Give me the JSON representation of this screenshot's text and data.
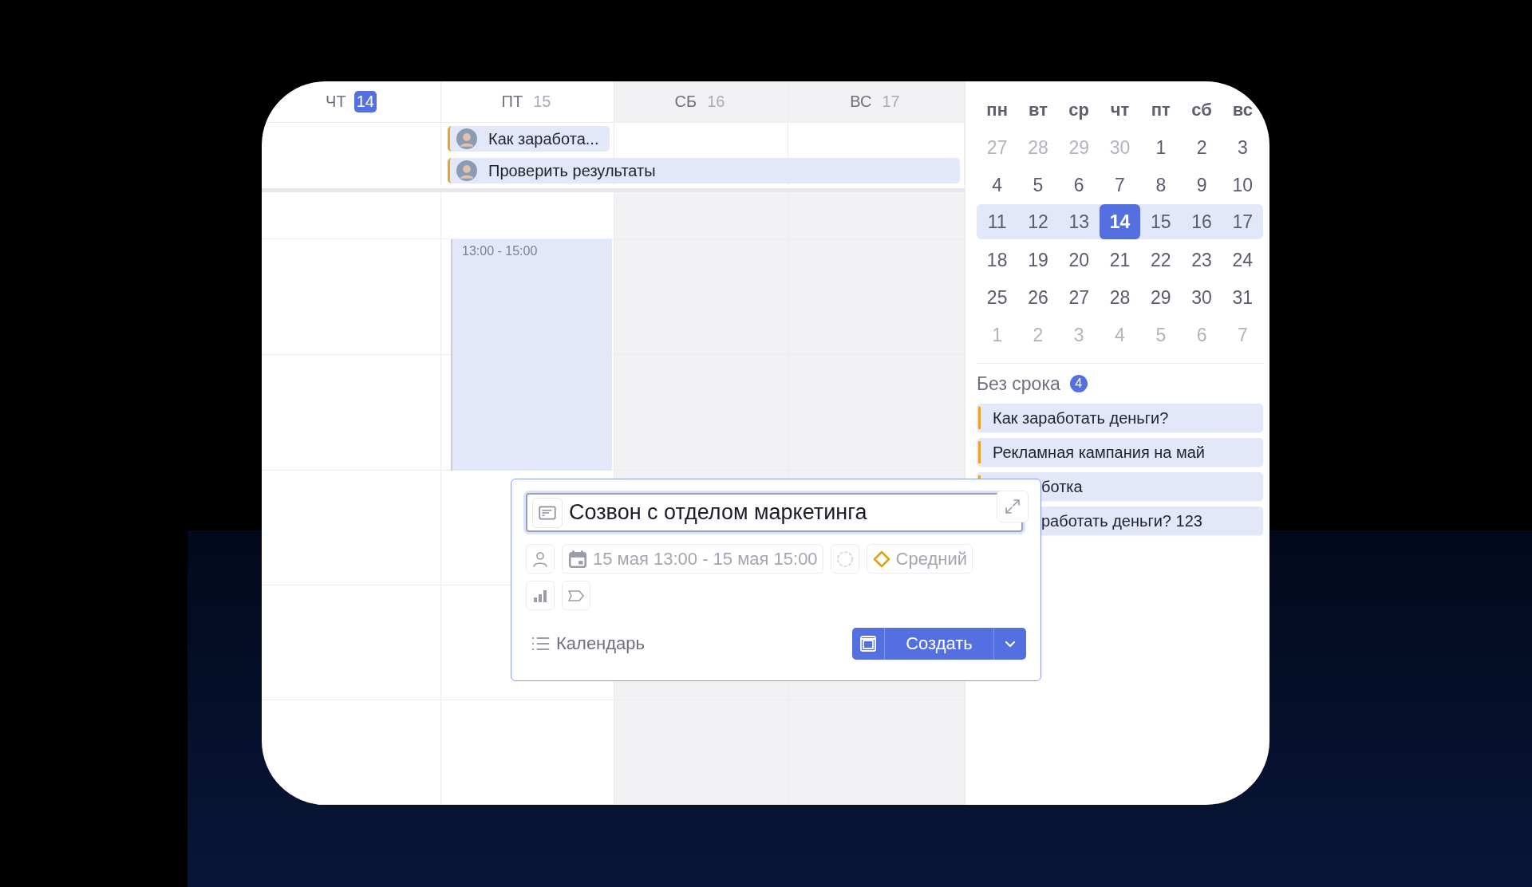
{
  "week_days": [
    {
      "label": "ЧТ",
      "date": "14",
      "today": true,
      "weekend": false
    },
    {
      "label": "ПТ",
      "date": "15",
      "today": false,
      "weekend": false,
      "all_day": [
        {
          "title": "Как заработа...",
          "kind": "single"
        },
        {
          "title": "Проверить результаты",
          "kind": "multi_day"
        }
      ],
      "timed": [
        {
          "time": "13:00 - 15:00"
        }
      ]
    },
    {
      "label": "СБ",
      "date": "16",
      "today": false,
      "weekend": true
    },
    {
      "label": "ВС",
      "date": "17",
      "today": false,
      "weekend": true
    }
  ],
  "mini_calendar": {
    "weekdays": [
      "пн",
      "вт",
      "ср",
      "чт",
      "пт",
      "сб",
      "вс"
    ],
    "weeks": [
      {
        "selected": false,
        "days": [
          {
            "day": "27",
            "muted": true,
            "selected": false
          },
          {
            "day": "28",
            "muted": true,
            "selected": false
          },
          {
            "day": "29",
            "muted": true,
            "selected": false
          },
          {
            "day": "30",
            "muted": true,
            "selected": false
          },
          {
            "day": "1",
            "muted": false,
            "selected": false
          },
          {
            "day": "2",
            "muted": false,
            "selected": false
          },
          {
            "day": "3",
            "muted": false,
            "selected": false
          }
        ]
      },
      {
        "selected": false,
        "days": [
          {
            "day": "4",
            "muted": false,
            "selected": false
          },
          {
            "day": "5",
            "muted": false,
            "selected": false
          },
          {
            "day": "6",
            "muted": false,
            "selected": false
          },
          {
            "day": "7",
            "muted": false,
            "selected": false
          },
          {
            "day": "8",
            "muted": false,
            "selected": false
          },
          {
            "day": "9",
            "muted": false,
            "selected": false
          },
          {
            "day": "10",
            "muted": false,
            "selected": false
          }
        ]
      },
      {
        "selected": true,
        "days": [
          {
            "day": "11",
            "muted": false,
            "selected": false
          },
          {
            "day": "12",
            "muted": false,
            "selected": false
          },
          {
            "day": "13",
            "muted": false,
            "selected": false
          },
          {
            "day": "14",
            "muted": false,
            "selected": true
          },
          {
            "day": "15",
            "muted": false,
            "selected": false
          },
          {
            "day": "16",
            "muted": false,
            "selected": false
          },
          {
            "day": "17",
            "muted": false,
            "selected": false
          }
        ]
      },
      {
        "selected": false,
        "days": [
          {
            "day": "18",
            "muted": false,
            "selected": false
          },
          {
            "day": "19",
            "muted": false,
            "selected": false
          },
          {
            "day": "20",
            "muted": false,
            "selected": false
          },
          {
            "day": "21",
            "muted": false,
            "selected": false
          },
          {
            "day": "22",
            "muted": false,
            "selected": false
          },
          {
            "day": "23",
            "muted": false,
            "selected": false
          },
          {
            "day": "24",
            "muted": false,
            "selected": false
          }
        ]
      },
      {
        "selected": false,
        "days": [
          {
            "day": "25",
            "muted": false,
            "selected": false
          },
          {
            "day": "26",
            "muted": false,
            "selected": false
          },
          {
            "day": "27",
            "muted": false,
            "selected": false
          },
          {
            "day": "28",
            "muted": false,
            "selected": false
          },
          {
            "day": "29",
            "muted": false,
            "selected": false
          },
          {
            "day": "30",
            "muted": false,
            "selected": false
          },
          {
            "day": "31",
            "muted": false,
            "selected": false
          }
        ]
      },
      {
        "selected": false,
        "days": [
          {
            "day": "1",
            "muted": true,
            "selected": false
          },
          {
            "day": "2",
            "muted": true,
            "selected": false
          },
          {
            "day": "3",
            "muted": true,
            "selected": false
          },
          {
            "day": "4",
            "muted": true,
            "selected": false
          },
          {
            "day": "5",
            "muted": true,
            "selected": false
          },
          {
            "day": "6",
            "muted": true,
            "selected": false
          },
          {
            "day": "7",
            "muted": true,
            "selected": false
          }
        ]
      }
    ]
  },
  "no_deadline": {
    "title": "Без срока",
    "count": "4",
    "tasks": [
      {
        "title": "Как заработать деньги?",
        "covered": false
      },
      {
        "title": "Рекламная кампания на май",
        "covered": false
      },
      {
        "title": "ботка",
        "covered": true
      },
      {
        "title": "работать деньги? 123",
        "covered": true
      }
    ]
  },
  "new_task_popup": {
    "title_value": "Созвон с отделом маркетинга",
    "date_range": "15 мая 13:00 - 15 мая 15:00",
    "priority": "Средний",
    "list": "Календарь",
    "create_button": "Создать"
  }
}
